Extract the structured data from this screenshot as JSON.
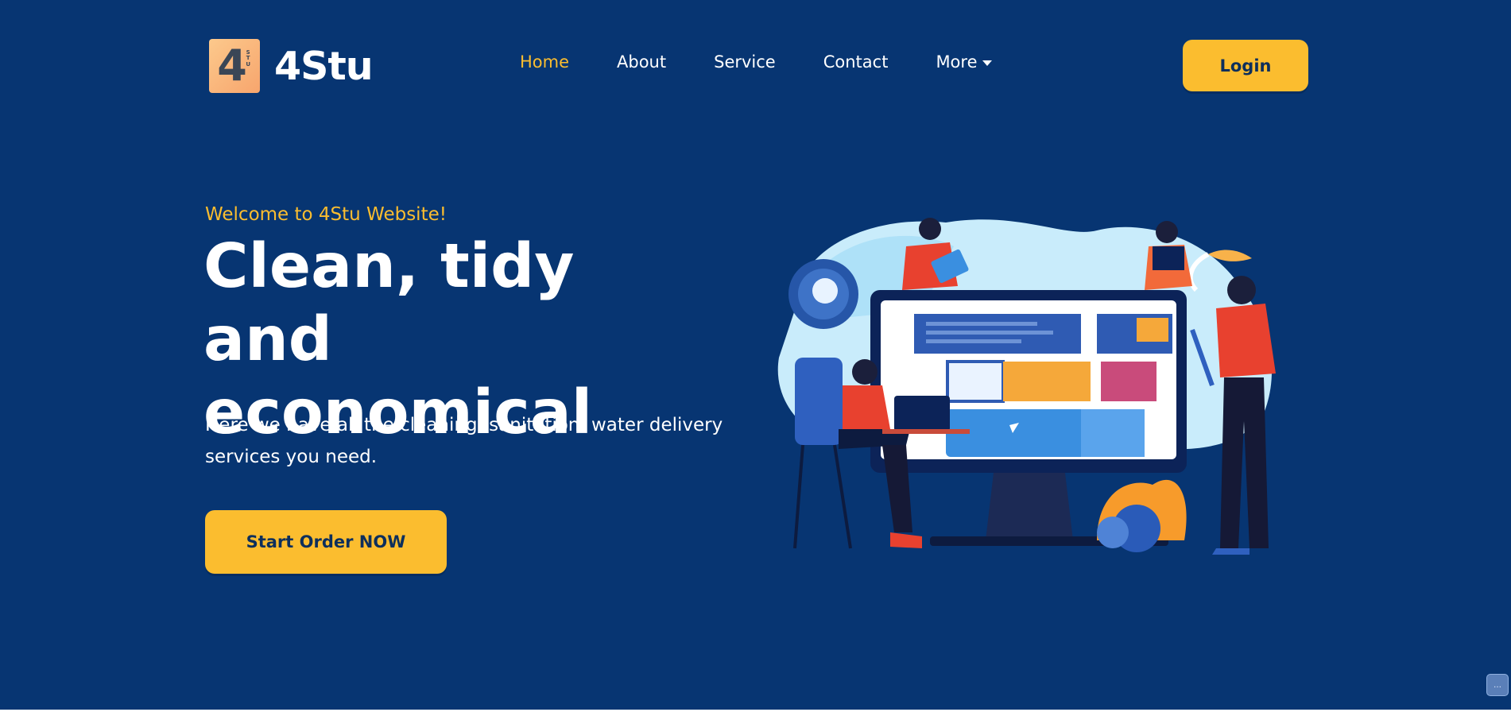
{
  "brand": {
    "logo_digit": "4",
    "logo_mini_letters": [
      "S",
      "T",
      "U"
    ],
    "name": "4Stu"
  },
  "nav": {
    "items": [
      {
        "label": "Home",
        "active": true
      },
      {
        "label": "About",
        "active": false
      },
      {
        "label": "Service",
        "active": false
      },
      {
        "label": "Contact",
        "active": false
      },
      {
        "label": "More",
        "active": false,
        "has_dropdown": true
      }
    ]
  },
  "header": {
    "login_label": "Login"
  },
  "hero": {
    "eyebrow": "Welcome to 4Stu Website!",
    "headline_line1": "Clean, tidy and",
    "headline_line2": "economical",
    "lead_line1": "Here we have all the cleaning, sanitation, water delivery",
    "lead_line2": "services you need.",
    "cta_label": "Start Order NOW"
  },
  "illustration": {
    "icon": "people-around-monitor-illustration"
  },
  "corner_widget": {
    "icon": "chat-widget-icon"
  },
  "colors": {
    "background": "#073572",
    "accent": "#fbbd2f",
    "text": "#ffffff",
    "button_text": "#0d2f5c"
  }
}
